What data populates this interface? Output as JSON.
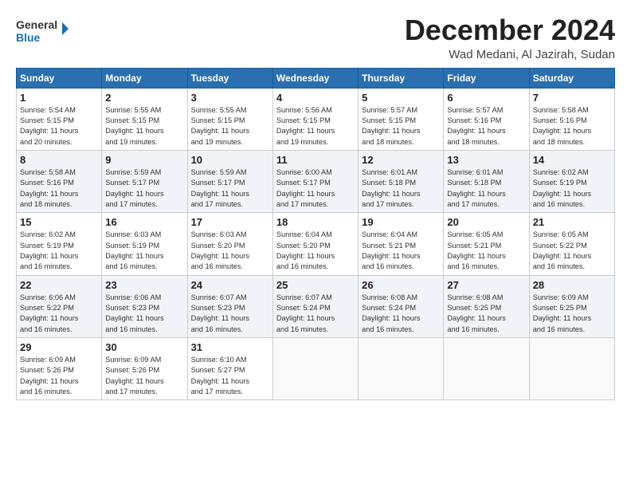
{
  "logo": {
    "line1": "General",
    "line2": "Blue"
  },
  "title": "December 2024",
  "subtitle": "Wad Medani, Al Jazirah, Sudan",
  "days_of_week": [
    "Sunday",
    "Monday",
    "Tuesday",
    "Wednesday",
    "Thursday",
    "Friday",
    "Saturday"
  ],
  "weeks": [
    [
      {
        "day": "1",
        "info": "Sunrise: 5:54 AM\nSunset: 5:15 PM\nDaylight: 11 hours\nand 20 minutes."
      },
      {
        "day": "2",
        "info": "Sunrise: 5:55 AM\nSunset: 5:15 PM\nDaylight: 11 hours\nand 19 minutes."
      },
      {
        "day": "3",
        "info": "Sunrise: 5:55 AM\nSunset: 5:15 PM\nDaylight: 11 hours\nand 19 minutes."
      },
      {
        "day": "4",
        "info": "Sunrise: 5:56 AM\nSunset: 5:15 PM\nDaylight: 11 hours\nand 19 minutes."
      },
      {
        "day": "5",
        "info": "Sunrise: 5:57 AM\nSunset: 5:15 PM\nDaylight: 11 hours\nand 18 minutes."
      },
      {
        "day": "6",
        "info": "Sunrise: 5:57 AM\nSunset: 5:16 PM\nDaylight: 11 hours\nand 18 minutes."
      },
      {
        "day": "7",
        "info": "Sunrise: 5:58 AM\nSunset: 5:16 PM\nDaylight: 11 hours\nand 18 minutes."
      }
    ],
    [
      {
        "day": "8",
        "info": "Sunrise: 5:58 AM\nSunset: 5:16 PM\nDaylight: 11 hours\nand 18 minutes."
      },
      {
        "day": "9",
        "info": "Sunrise: 5:59 AM\nSunset: 5:17 PM\nDaylight: 11 hours\nand 17 minutes."
      },
      {
        "day": "10",
        "info": "Sunrise: 5:59 AM\nSunset: 5:17 PM\nDaylight: 11 hours\nand 17 minutes."
      },
      {
        "day": "11",
        "info": "Sunrise: 6:00 AM\nSunset: 5:17 PM\nDaylight: 11 hours\nand 17 minutes."
      },
      {
        "day": "12",
        "info": "Sunrise: 6:01 AM\nSunset: 5:18 PM\nDaylight: 11 hours\nand 17 minutes."
      },
      {
        "day": "13",
        "info": "Sunrise: 6:01 AM\nSunset: 5:18 PM\nDaylight: 11 hours\nand 17 minutes."
      },
      {
        "day": "14",
        "info": "Sunrise: 6:02 AM\nSunset: 5:19 PM\nDaylight: 11 hours\nand 16 minutes."
      }
    ],
    [
      {
        "day": "15",
        "info": "Sunrise: 6:02 AM\nSunset: 5:19 PM\nDaylight: 11 hours\nand 16 minutes."
      },
      {
        "day": "16",
        "info": "Sunrise: 6:03 AM\nSunset: 5:19 PM\nDaylight: 11 hours\nand 16 minutes."
      },
      {
        "day": "17",
        "info": "Sunrise: 6:03 AM\nSunset: 5:20 PM\nDaylight: 11 hours\nand 16 minutes."
      },
      {
        "day": "18",
        "info": "Sunrise: 6:04 AM\nSunset: 5:20 PM\nDaylight: 11 hours\nand 16 minutes."
      },
      {
        "day": "19",
        "info": "Sunrise: 6:04 AM\nSunset: 5:21 PM\nDaylight: 11 hours\nand 16 minutes."
      },
      {
        "day": "20",
        "info": "Sunrise: 6:05 AM\nSunset: 5:21 PM\nDaylight: 11 hours\nand 16 minutes."
      },
      {
        "day": "21",
        "info": "Sunrise: 6:05 AM\nSunset: 5:22 PM\nDaylight: 11 hours\nand 16 minutes."
      }
    ],
    [
      {
        "day": "22",
        "info": "Sunrise: 6:06 AM\nSunset: 5:22 PM\nDaylight: 11 hours\nand 16 minutes."
      },
      {
        "day": "23",
        "info": "Sunrise: 6:06 AM\nSunset: 5:23 PM\nDaylight: 11 hours\nand 16 minutes."
      },
      {
        "day": "24",
        "info": "Sunrise: 6:07 AM\nSunset: 5:23 PM\nDaylight: 11 hours\nand 16 minutes."
      },
      {
        "day": "25",
        "info": "Sunrise: 6:07 AM\nSunset: 5:24 PM\nDaylight: 11 hours\nand 16 minutes."
      },
      {
        "day": "26",
        "info": "Sunrise: 6:08 AM\nSunset: 5:24 PM\nDaylight: 11 hours\nand 16 minutes."
      },
      {
        "day": "27",
        "info": "Sunrise: 6:08 AM\nSunset: 5:25 PM\nDaylight: 11 hours\nand 16 minutes."
      },
      {
        "day": "28",
        "info": "Sunrise: 6:09 AM\nSunset: 5:25 PM\nDaylight: 11 hours\nand 16 minutes."
      }
    ],
    [
      {
        "day": "29",
        "info": "Sunrise: 6:09 AM\nSunset: 5:26 PM\nDaylight: 11 hours\nand 16 minutes."
      },
      {
        "day": "30",
        "info": "Sunrise: 6:09 AM\nSunset: 5:26 PM\nDaylight: 11 hours\nand 17 minutes."
      },
      {
        "day": "31",
        "info": "Sunrise: 6:10 AM\nSunset: 5:27 PM\nDaylight: 11 hours\nand 17 minutes."
      },
      null,
      null,
      null,
      null
    ]
  ]
}
